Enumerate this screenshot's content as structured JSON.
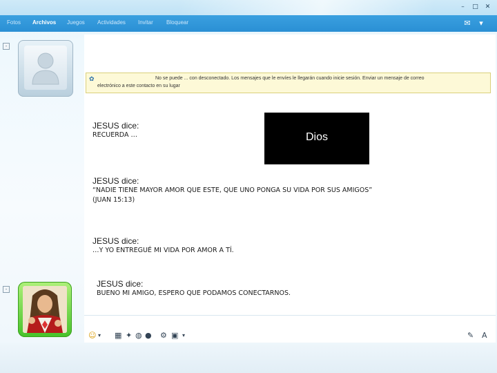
{
  "window": {
    "controls": [
      "–",
      "□",
      "✕"
    ]
  },
  "menubar": {
    "items": [
      {
        "label": "Fotos"
      },
      {
        "label": "Archivos"
      },
      {
        "label": "Juegos"
      },
      {
        "label": "Actividades"
      },
      {
        "label": "Invitar"
      },
      {
        "label": "Bloquear"
      }
    ],
    "active": "Archivos",
    "right_icons": [
      "chat-bubble-icon",
      "menu-icon"
    ]
  },
  "infobar": {
    "line1": "No se puede ... con desconectado. Los mensajes que le envíes le llegarán cuando inicie sesión. Enviar un mensaje de correo",
    "line2": "electrónico a este contacto en su lugar"
  },
  "messages": [
    {
      "sender": "JESUS dice:",
      "text": "RECUERDA …"
    },
    {
      "sender": "JESUS dice:",
      "text": "“NADIE TIENE MAYOR AMOR QUE ESTE, QUE UNO PONGA SU VIDA POR SUS AMIGOS”",
      "text2": "(JUAN 15:13)"
    },
    {
      "sender": "JESUS dice:",
      "text": "…Y YO ENTREGUÉ MI VIDA POR AMOR A TÍ."
    },
    {
      "sender": "JESUS dice:",
      "text": "BUENO MI AMIGO, ESPERO QUE PODAMOS CONECTARNOS."
    }
  ],
  "image": {
    "label": "Dios"
  },
  "colors": {
    "menubar": "#2a8fd4",
    "infobar_bg": "#fdf9d7",
    "avatar_green": "#46c22a"
  }
}
